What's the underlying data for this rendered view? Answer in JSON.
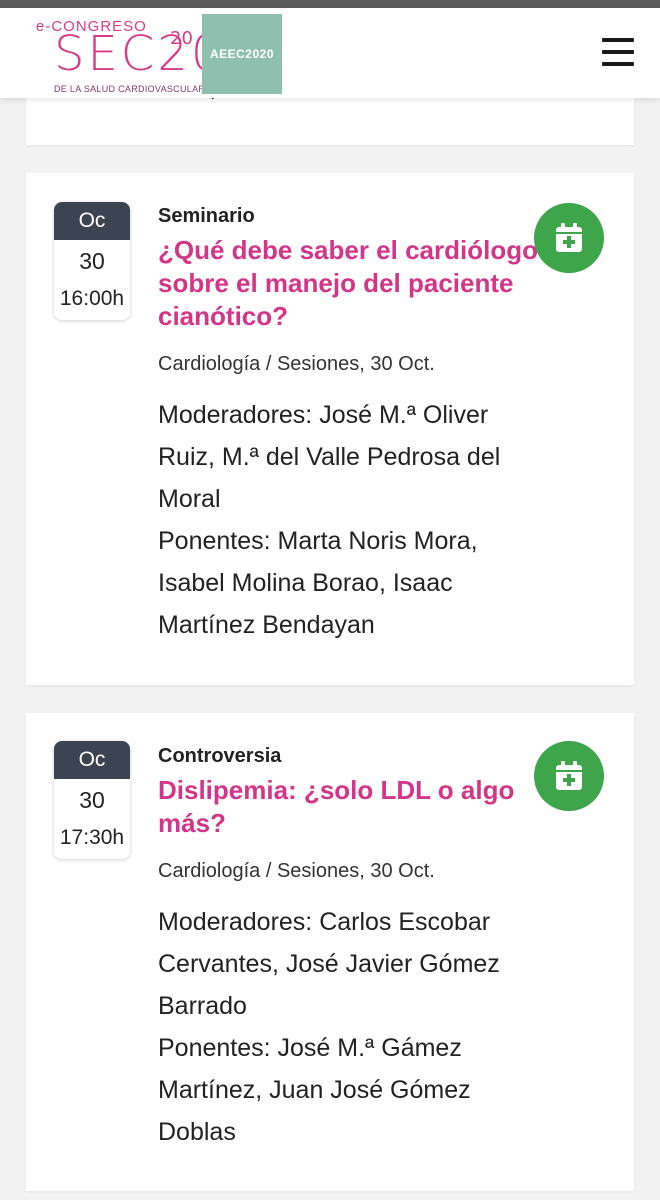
{
  "header": {
    "logo": {
      "top_text": "e-CONGRESO",
      "main_text": "SEC20",
      "superscript": "20",
      "bottom_text": "DE LA SALUD CARDIOVASCULAR"
    },
    "badge_text": "AEEC2020",
    "menu_icon": "hamburger-menu-icon"
  },
  "previous_card": {
    "cutoff_text": "Díaz, David Calvo Cuervo"
  },
  "sessions": [
    {
      "month": "Oc",
      "day": "30",
      "time": "16:00h",
      "type": "Seminario",
      "title": "¿Qué debe saber el cardiólogo sobre el manejo del paciente cianótico?",
      "meta": "Cardiología / Sesiones, 30 Oct.",
      "moderators": "Moderadores: José M.ª Oliver Ruiz, M.ª del Valle Pedrosa del Moral",
      "speakers": "Ponentes: Marta Noris Mora, Isabel Molina Borao, Isaac Martínez Bendayan",
      "action_icon": "calendar-add-icon"
    },
    {
      "month": "Oc",
      "day": "30",
      "time": "17:30h",
      "type": "Controversia",
      "title": "Dislipemia: ¿solo LDL o algo más?",
      "meta": "Cardiología / Sesiones, 30 Oct.",
      "moderators": "Moderadores: Carlos Escobar Cervantes, José Javier Gómez Barrado",
      "speakers": "Ponentes: José M.ª Gámez Martínez, Juan José Gómez Doblas",
      "action_icon": "calendar-add-icon"
    }
  ],
  "colors": {
    "accent_pink": "#d33589",
    "date_header": "#3d4451",
    "add_button": "#3fa54a",
    "badge_bg": "#8fbfaf"
  }
}
